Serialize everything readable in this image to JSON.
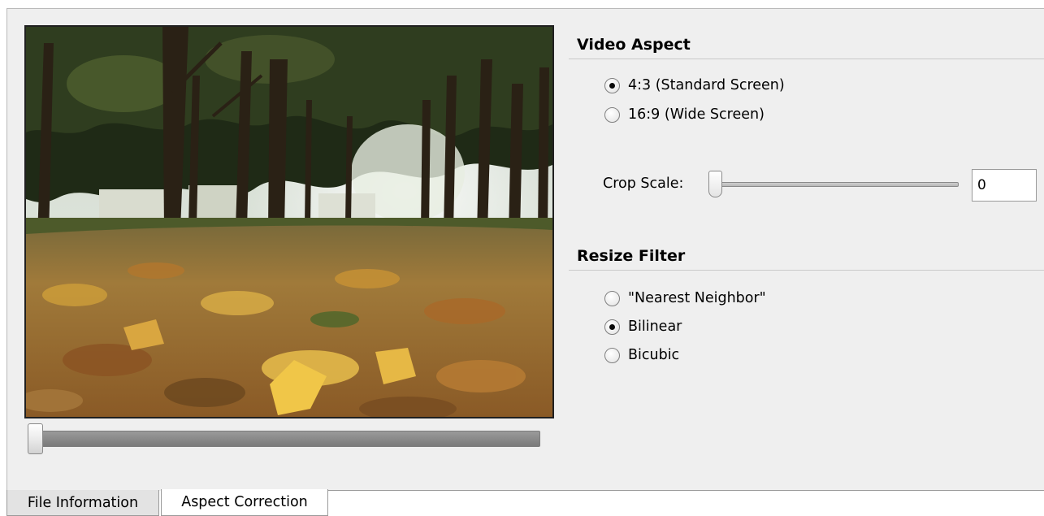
{
  "video_aspect": {
    "title": "Video Aspect",
    "options": [
      {
        "label": "4:3 (Standard Screen)",
        "checked": true
      },
      {
        "label": "16:9 (Wide Screen)",
        "checked": false
      }
    ]
  },
  "crop_scale": {
    "label": "Crop Scale:",
    "value": "0",
    "slider_level": 0
  },
  "resize_filter": {
    "title": "Resize Filter",
    "options": [
      {
        "label": "\"Nearest Neighbor\"",
        "checked": false
      },
      {
        "label": "Bilinear",
        "checked": true
      },
      {
        "label": "Bicubic",
        "checked": false
      }
    ]
  },
  "preview": {
    "image": "autumn-park-leaves-preview",
    "seek_level": 0
  },
  "tabs": [
    {
      "label": "File Information",
      "active": false
    },
    {
      "label": "Aspect Correction",
      "active": true
    }
  ]
}
